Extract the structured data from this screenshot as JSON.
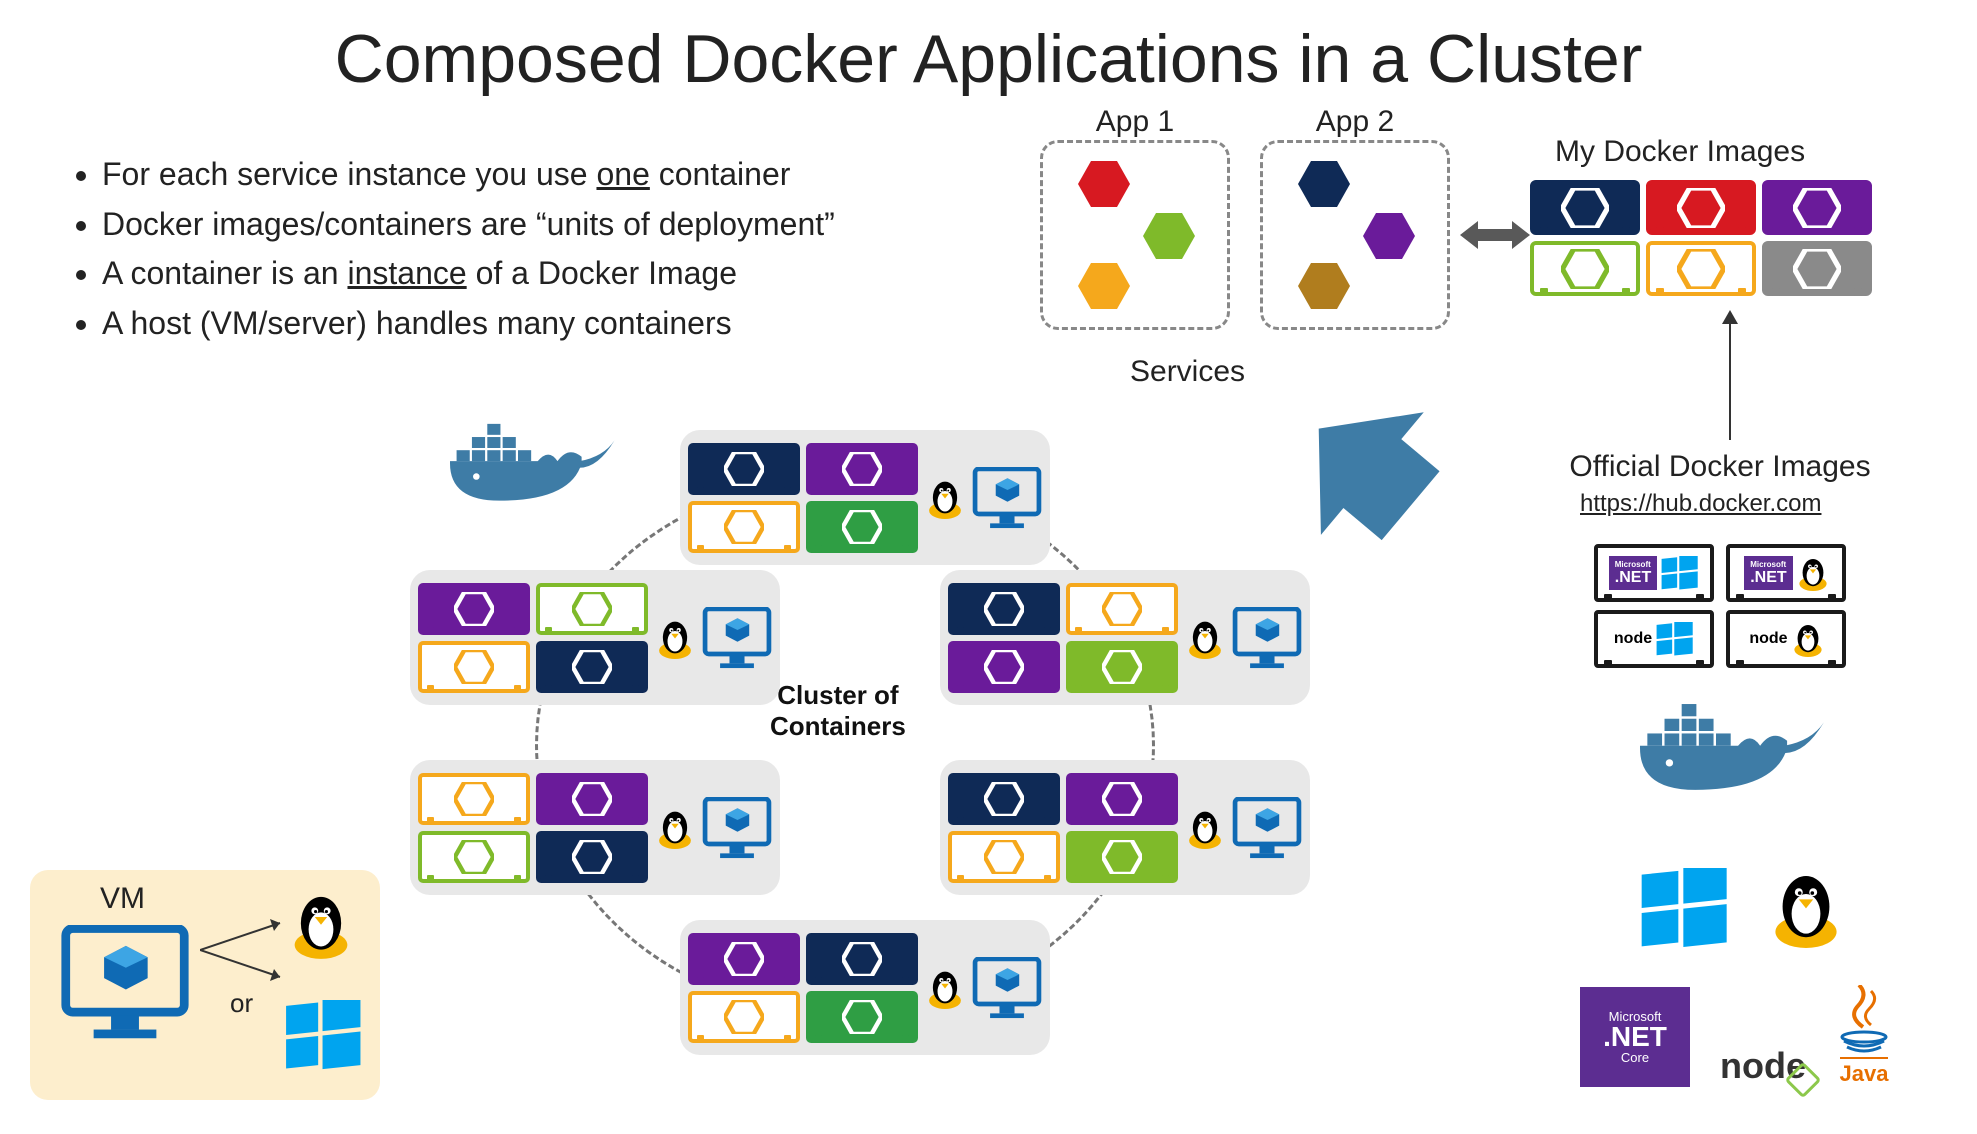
{
  "title": "Composed Docker Applications in a Cluster",
  "bullets": [
    {
      "pre": "For each service instance you use ",
      "u": "one",
      "post": " container"
    },
    {
      "pre": "Docker images/containers are “units of deployment”",
      "u": "",
      "post": ""
    },
    {
      "pre": "A container is an ",
      "u": "instance",
      "post": " of a Docker Image"
    },
    {
      "pre": "A host (VM/server) handles many containers",
      "u": "",
      "post": ""
    }
  ],
  "apps": {
    "app1_label": "App 1",
    "app2_label": "App 2",
    "services_label": "Services"
  },
  "my_images_label": "My Docker Images",
  "official_label": "Official Docker Images",
  "hub_link": "https://hub.docker.com",
  "cluster_label_line1": "Cluster of",
  "cluster_label_line2": "Containers",
  "vm_legend": {
    "vm": "VM",
    "or": "or"
  },
  "colors": {
    "red": "#d71921",
    "yellow": "#f5a81c",
    "green": "#7fba2a",
    "dgreen": "#2f9e44",
    "navy": "#0f2a56",
    "purple": "#6a1b9a",
    "brown": "#b07d1e",
    "gray": "#8a8a8a",
    "blue": "#0f6ab4",
    "steel": "#3e7ca6"
  },
  "official_images": [
    {
      "tech": ".NET",
      "os": "windows"
    },
    {
      "tech": ".NET",
      "os": "linux"
    },
    {
      "tech": "node",
      "os": "windows"
    },
    {
      "tech": "node",
      "os": "linux"
    }
  ],
  "tech_labels": {
    "node": "node",
    "java": "Java",
    "net_ms": "Microsoft",
    "net": ".NET",
    "net_core": "Core"
  }
}
